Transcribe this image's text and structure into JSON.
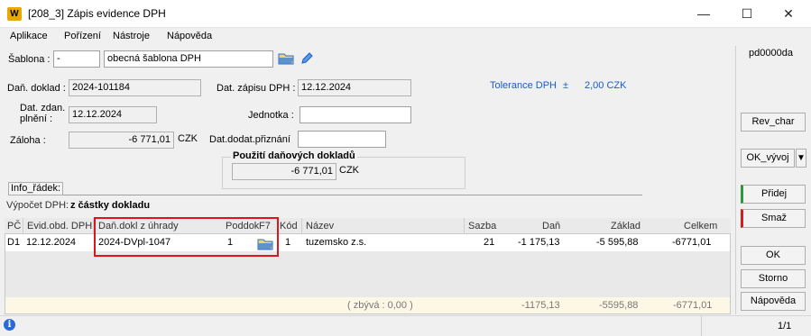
{
  "window": {
    "logo": "W",
    "title": "[208_3] Zápis evidence DPH",
    "minimize": "—",
    "maximize": "☐",
    "close": "✕"
  },
  "menu": [
    "Aplikace",
    "Pořízení",
    "Nástroje",
    "Nápověda"
  ],
  "form": {
    "sablona_label": "Šablona :",
    "sablona_code": "-",
    "sablona_name": "obecná šablona DPH",
    "dan_doklad_label": "Daň. doklad :",
    "dan_doklad_value": "2024-101184",
    "dat_zapisu_label": "Dat. zápisu DPH :",
    "dat_zapisu_value": "12.12.2024",
    "tolerance_label": "Tolerance DPH",
    "tolerance_sign": "±",
    "tolerance_value": "2,00 CZK",
    "dat_zdan_label_1": "Dat. zdan.",
    "dat_zdan_label_2": "plnění :",
    "dat_zdan_value": "12.12.2024",
    "jednotka_label": "Jednotka :",
    "jednotka_value": "",
    "zaloha_label": "Záloha :",
    "zaloha_value": "-6 771,01",
    "zaloha_currency": "CZK",
    "dat_dodat_label": "Dat.dodat.přiznání",
    "dat_dodat_value": "",
    "pouziti_title": "Použití daňových dokladů",
    "pouziti_value": "-6 771,01",
    "pouziti_currency": "CZK",
    "info_button": "Info_řádek:",
    "vypocet_label": "Výpočet DPH:",
    "vypocet_value": "z částky dokladu"
  },
  "right_panel": {
    "user_code": "pd0000da",
    "rev_char": "Rev_char",
    "ok_vyvoj": "OK_vývoj",
    "ok_vyvoj_arrow": "▼",
    "pridej": "Přidej",
    "smaz": "Smaž",
    "ok": "OK",
    "storno": "Storno",
    "napoveda": "Nápověda"
  },
  "grid": {
    "headers": {
      "pc": "PČ",
      "evid": "Evid.obd. DPH",
      "dan_dokl": "Daň.dokl z úhrady",
      "poddok": "Poddok",
      "f7": "F7",
      "kod": "Kód",
      "nazev": "Název",
      "sazba": "Sazba",
      "dan": "Daň",
      "zaklad": "Základ",
      "celkem": "Celkem"
    },
    "row": {
      "pc": "D1",
      "evid": "12.12.2024",
      "dan_dokl": "2024-DVpl-1047",
      "poddok": "1",
      "kod": "1",
      "nazev": "tuzemsko z.s.",
      "sazba": "21",
      "dan": "-1 175,13",
      "zaklad": "-5 595,88",
      "celkem": "-6771,01"
    },
    "summary": {
      "zbyva": "( zbývá : 0,00 )",
      "dan": "-1175,13",
      "zaklad": "-5595,88",
      "celkem": "-6771,01"
    }
  },
  "status": {
    "info_icon": "i",
    "page": "1/1"
  },
  "colors": {
    "highlight": "#e0151b",
    "link_blue": "#1a5cc8",
    "add_flag": "#2a9a3a",
    "delete_flag": "#d02020"
  }
}
